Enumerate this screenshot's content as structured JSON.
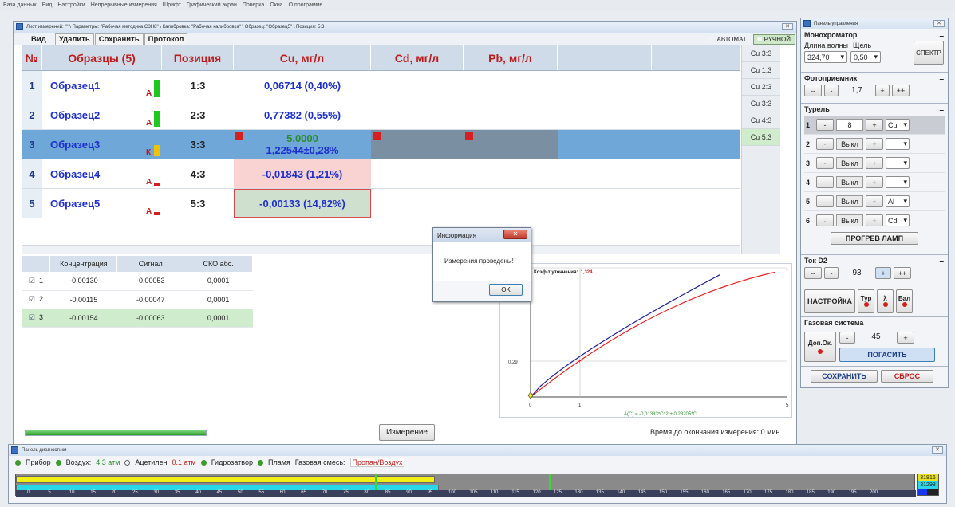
{
  "menu": [
    "База данных",
    "Вид",
    "Настройки",
    "Непрерывные измерения",
    "Шрифт",
    "Графический экран",
    "Поверка",
    "Окна",
    "О программе"
  ],
  "meas_window": {
    "title": "Лист измерений: \"\" \\ Параметры: \"Рабочая методика СЗН8\" \\ Калибровка: \"Рабочая калибровка\" \\ Образец: \"Образец5\" \\ Позиция: 5:3",
    "toolbar": {
      "view": "Вид",
      "delete": "Удалить",
      "save": "Сохранить",
      "protocol": "Протокол"
    },
    "mode_auto": "АВТОМАТ",
    "mode_manual": "РУЧНОЙ",
    "headers": {
      "num": "№",
      "samples": "Образцы (5)",
      "position": "Позиция",
      "cu": "Cu, мг/л",
      "cd": "Cd, мг/л",
      "pb": "Pb, мг/л"
    },
    "rows": [
      {
        "num": "1",
        "name": "Образец1",
        "tag": "А",
        "pos": "1:3",
        "cu": "0,06714 (0,40%)"
      },
      {
        "num": "2",
        "name": "Образец2",
        "tag": "А",
        "pos": "2:3",
        "cu": "0,77382 (0,55%)"
      },
      {
        "num": "3",
        "name": "Образец3",
        "tag": "К",
        "pos": "3:3",
        "cu_top": "5,0000",
        "cu": "1,22544±0,28%"
      },
      {
        "num": "4",
        "name": "Образец4",
        "tag": "А",
        "pos": "4:3",
        "cu": "-0,01843 (1,21%)"
      },
      {
        "num": "5",
        "name": "Образец5",
        "tag": "А",
        "pos": "5:3",
        "cu": "-0,00133 (14,82%)"
      }
    ],
    "side_list": [
      "Cu 3:3",
      "Cu 1:3",
      "Cu 2:3",
      "Cu 3:3",
      "Cu 4:3",
      "Cu 5:3"
    ],
    "subgrid": {
      "headers": [
        "Концентрация",
        "Сигнал",
        "СКО абс."
      ],
      "rows": [
        {
          "n": "1",
          "conc": "-0,00130",
          "signal": "-0,00053",
          "sko": "0,0001"
        },
        {
          "n": "2",
          "conc": "-0,00115",
          "signal": "-0,00047",
          "sko": "0,0001"
        },
        {
          "n": "3",
          "conc": "-0,00154",
          "signal": "-0,00063",
          "sko": "0,0001"
        }
      ]
    },
    "chart": {
      "coef_label": "Коэф-т уточнения:",
      "coef_value": "1,324",
      "ytick": "0,29",
      "xticks": [
        "0",
        "1",
        "5"
      ],
      "formula": "A(C) = -0,01383*C^2 + 0,23205*C"
    },
    "measure_button": "Измерение",
    "time_left": "Время до окончания измерения: 0 мин.",
    "progress": 1.0
  },
  "dialog": {
    "title": "Информация",
    "message": "Измерения проведены!",
    "ok": "OK"
  },
  "control_panel": {
    "title": "Панель управления",
    "mono": {
      "title": "Монохроматор",
      "wl_label": "Длина волны",
      "slit_label": "Щель",
      "wl": "324,70",
      "slit": "0,50",
      "spectrum": "СПЕКТР"
    },
    "photo": {
      "title": "Фотоприемник",
      "value": "1,7"
    },
    "turret": {
      "title": "Турель",
      "rows": [
        {
          "n": "1",
          "val": "8",
          "el": "Cu"
        },
        {
          "n": "2",
          "val": "Выкл",
          "el": ""
        },
        {
          "n": "3",
          "val": "Выкл",
          "el": ""
        },
        {
          "n": "4",
          "val": "Выкл",
          "el": ""
        },
        {
          "n": "5",
          "val": "Выкл",
          "el": "Al"
        },
        {
          "n": "6",
          "val": "Выкл",
          "el": "Cd"
        }
      ],
      "warmup": "ПРОГРЕВ ЛАМП"
    },
    "d2": {
      "title": "Ток D2",
      "value": "93"
    },
    "settings": "НАСТРОЙКА",
    "tur": "Тур",
    "lambda": "λ",
    "bal": "Бал",
    "gas": {
      "title": "Газовая система",
      "aux": "Доп.Ок.",
      "value": "45",
      "extinguish": "ПОГАСИТЬ"
    },
    "save": "СОХРАНИТЬ",
    "reset": "СБРОС"
  },
  "diag": {
    "title": "Панель диагностики",
    "items": [
      "Прибор",
      "Воздух:",
      "Ацетилен",
      "Гидрозатвор",
      "Пламя"
    ],
    "air": "4.3 атм",
    "acetylene": "0.1 атм",
    "gas_mix_label": "Газовая смесь:",
    "gas_mix": "Пропан/Воздух",
    "val1": "31816",
    "val2": "31298",
    "ticks": [
      "0",
      "5",
      "10",
      "15",
      "20",
      "25",
      "30",
      "35",
      "40",
      "45",
      "50",
      "55",
      "60",
      "65",
      "70",
      "75",
      "80",
      "85",
      "90",
      "95",
      "100",
      "105",
      "110",
      "115",
      "120",
      "125",
      "130",
      "135",
      "140",
      "145",
      "150",
      "155",
      "160",
      "165",
      "170",
      "175",
      "180",
      "185",
      "190",
      "195",
      "200"
    ]
  }
}
